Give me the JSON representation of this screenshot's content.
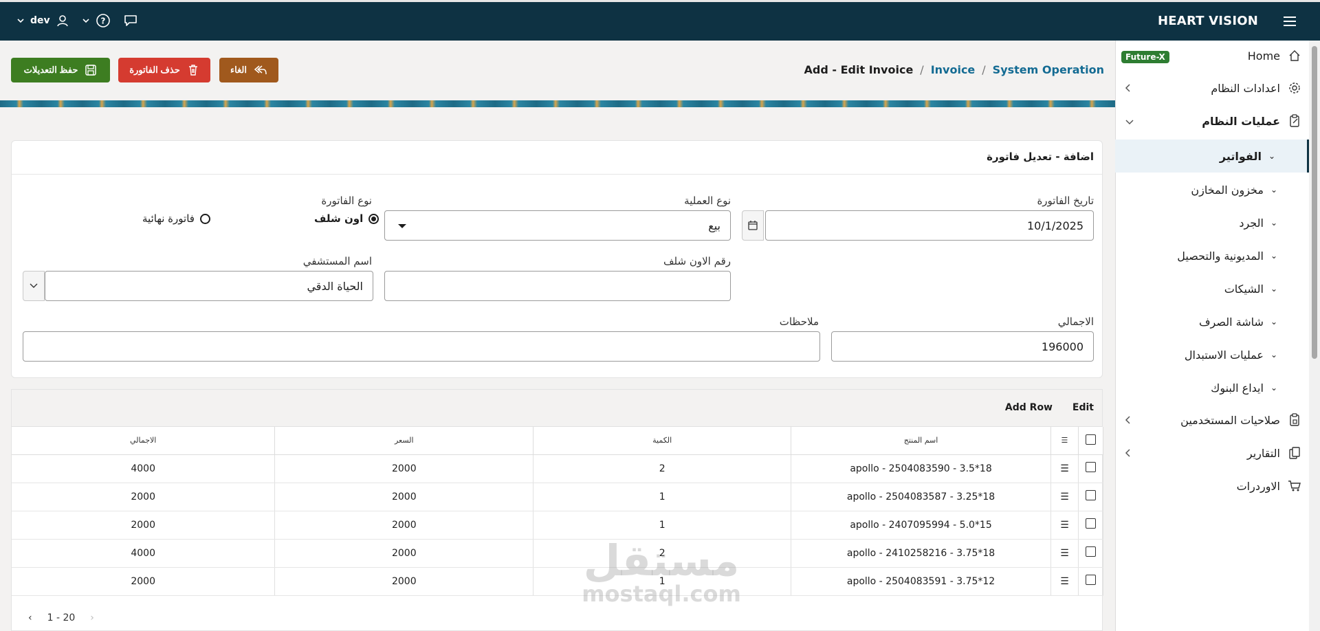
{
  "header": {
    "brand": "HEART VISION",
    "user": "dev"
  },
  "breadcrumb": {
    "current": "Add - Edit Invoice",
    "level2": "Invoice",
    "level1": "System Operation",
    "sep": "/"
  },
  "actions": {
    "save": "حفظ التعديلات",
    "delete": "حذف الفاتورة",
    "cancel": "الغاء"
  },
  "sidebar": {
    "badge": "Future-X",
    "items": [
      {
        "label": "Home"
      },
      {
        "label": "اعدادات النظام"
      },
      {
        "label": "عمليات النظام"
      },
      {
        "label": "الفواتير"
      },
      {
        "label": "مخزون المخازن"
      },
      {
        "label": "الجرد"
      },
      {
        "label": "المديونية والتحصيل"
      },
      {
        "label": "الشيكات"
      },
      {
        "label": "شاشة الصرف"
      },
      {
        "label": "عمليات الاستبدال"
      },
      {
        "label": "ايداع البنوك"
      },
      {
        "label": "صلاحيات المستخدمين"
      },
      {
        "label": "التقارير"
      },
      {
        "label": "الاوردرات"
      }
    ]
  },
  "form": {
    "title": "اضافة - تعديل فاتورة",
    "invoice_date_label": "تاريخ الفاتورة",
    "invoice_date": "10/1/2025",
    "operation_type_label": "نوع العملية",
    "operation_type": "بيع",
    "invoice_type_label": "نوع الفاتورة",
    "invoice_type_opt1": "اون شلف",
    "invoice_type_opt2": "فاتورة نهائية",
    "onshelf_no_label": "رقم الاون شلف",
    "onshelf_no": "",
    "hospital_label": "اسم المستشفي",
    "hospital": "الحياة الدقي",
    "total_label": "الاجمالي",
    "total": "196000",
    "notes_label": "ملاحظات",
    "notes": ""
  },
  "grid": {
    "edit": "Edit",
    "add_row": "Add Row",
    "columns": [
      "اسم المنتج",
      "الكمية",
      "السعر",
      "الاجمالي"
    ],
    "rows": [
      {
        "product": "apollo - 2504083590 - 3.5*18",
        "qty": "2",
        "price": "2000",
        "total": "4000"
      },
      {
        "product": "apollo - 2504083587 - 3.25*18",
        "qty": "1",
        "price": "2000",
        "total": "2000"
      },
      {
        "product": "apollo - 2407095994 - 5.0*15",
        "qty": "1",
        "price": "2000",
        "total": "2000"
      },
      {
        "product": "apollo - 2410258216 - 3.75*18",
        "qty": "2",
        "price": "2000",
        "total": "4000"
      },
      {
        "product": "apollo - 2504083591 - 3.75*12",
        "qty": "1",
        "price": "2000",
        "total": "2000"
      }
    ],
    "pager": "1 - 20"
  },
  "watermark": {
    "ar": "مستقل",
    "en": "mostaql.com"
  }
}
